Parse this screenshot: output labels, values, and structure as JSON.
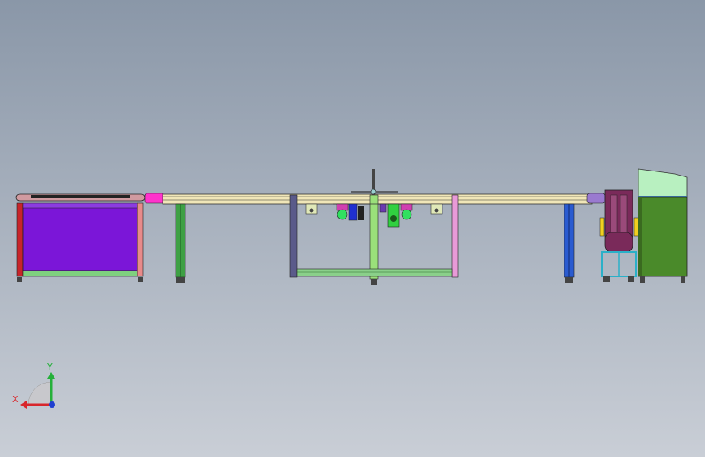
{
  "scene": {
    "title": "",
    "background_top": "#8a97a8",
    "background_bottom": "#c9ced6"
  },
  "triad": {
    "x_label": "X",
    "y_label": "Y",
    "x_color": "#d8262b",
    "y_color": "#25b03a",
    "z_color": "#2040d0"
  },
  "components": {
    "left_cabinet_color": "#7b16d8",
    "frame_red": "#c8242a",
    "frame_pink": "#e88a8a",
    "frame_green_light": "#7fd07f",
    "rail_color": "#f0e6b8",
    "leg_green": "#3ea044",
    "leg_blue": "#2a5bd0",
    "magenta_block": "#ff33cc",
    "lavender_block": "#9a7ad0",
    "right_machine_green": "#4a8a2a",
    "right_machine_top": "#b8f0c0",
    "unwinder_body": "#7a2a5a"
  }
}
